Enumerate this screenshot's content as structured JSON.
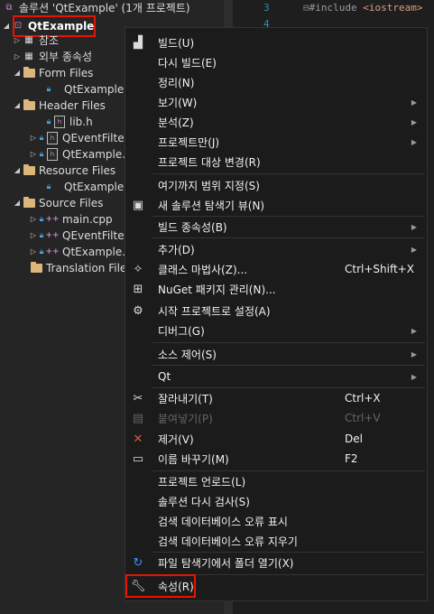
{
  "solution_header": "솔루션 'QtExample' (1개 프로젝트)",
  "tree": {
    "project": "QtExample",
    "items": [
      {
        "label": "참조"
      },
      {
        "label": "외부 종속성"
      },
      {
        "label": "Form Files"
      },
      {
        "label": "QtExample."
      },
      {
        "label": "Header Files"
      },
      {
        "label": "lib.h"
      },
      {
        "label": "QEventFilte"
      },
      {
        "label": "QtExample."
      },
      {
        "label": "Resource Files"
      },
      {
        "label": "QtExample."
      },
      {
        "label": "Source Files"
      },
      {
        "label": "main.cpp"
      },
      {
        "label": "QEventFilte"
      },
      {
        "label": "QtExample."
      },
      {
        "label": "Translation File"
      }
    ]
  },
  "editor": {
    "line3": "3",
    "line4": "4",
    "code_prefix": "#include ",
    "code_str": "<iostream>",
    "fold": "⊟"
  },
  "menu": {
    "items": [
      {
        "label": "빌드(U)",
        "shortcut": "",
        "icon": "build-icon"
      },
      {
        "label": "다시 빌드(E)",
        "shortcut": ""
      },
      {
        "label": "정리(N)",
        "shortcut": ""
      },
      {
        "label": "보기(W)",
        "shortcut": "",
        "submenu": true
      },
      {
        "label": "분석(Z)",
        "shortcut": "",
        "submenu": true
      },
      {
        "label": "프로젝트만(J)",
        "shortcut": "",
        "submenu": true
      },
      {
        "label": "프로젝트 대상 변경(R)",
        "shortcut": ""
      },
      {
        "label": "여기까지 범위 지정(S)",
        "shortcut": ""
      },
      {
        "label": "새 솔루션 탐색기 뷰(N)",
        "shortcut": "",
        "icon": "new-view-icon"
      },
      {
        "label": "빌드 종속성(B)",
        "shortcut": "",
        "submenu": true
      },
      {
        "label": "추가(D)",
        "shortcut": "",
        "submenu": true
      },
      {
        "label": "클래스 마법사(Z)...",
        "shortcut": "Ctrl+Shift+X",
        "icon": "class-wizard-icon"
      },
      {
        "label": "NuGet 패키지 관리(N)...",
        "shortcut": "",
        "icon": "nuget-icon"
      },
      {
        "label": "시작 프로젝트로 설정(A)",
        "shortcut": "",
        "icon": "gear-icon"
      },
      {
        "label": "디버그(G)",
        "shortcut": "",
        "submenu": true
      },
      {
        "label": "소스 제어(S)",
        "shortcut": "",
        "submenu": true
      },
      {
        "label": "Qt",
        "shortcut": "",
        "submenu": true
      },
      {
        "label": "잘라내기(T)",
        "shortcut": "Ctrl+X",
        "icon": "cut-icon"
      },
      {
        "label": "붙여넣기(P)",
        "shortcut": "Ctrl+V",
        "icon": "paste-icon",
        "disabled": true
      },
      {
        "label": "제거(V)",
        "shortcut": "Del",
        "icon": "remove-icon"
      },
      {
        "label": "이름 바꾸기(M)",
        "shortcut": "F2",
        "icon": "rename-icon"
      },
      {
        "label": "프로젝트 언로드(L)",
        "shortcut": ""
      },
      {
        "label": "솔루션 다시 검사(S)",
        "shortcut": ""
      },
      {
        "label": "검색 데이터베이스 오류 표시",
        "shortcut": ""
      },
      {
        "label": "검색 데이터베이스 오류 지우기",
        "shortcut": ""
      },
      {
        "label": "파일 탐색기에서 폴더 열기(X)",
        "shortcut": "",
        "icon": "open-folder-icon"
      },
      {
        "label": "속성(R)",
        "shortcut": "",
        "icon": "wrench-icon"
      }
    ]
  },
  "colors": {
    "highlight_border": "#e51400",
    "menu_bg": "#1b1b1c",
    "panel_bg": "#252526"
  }
}
